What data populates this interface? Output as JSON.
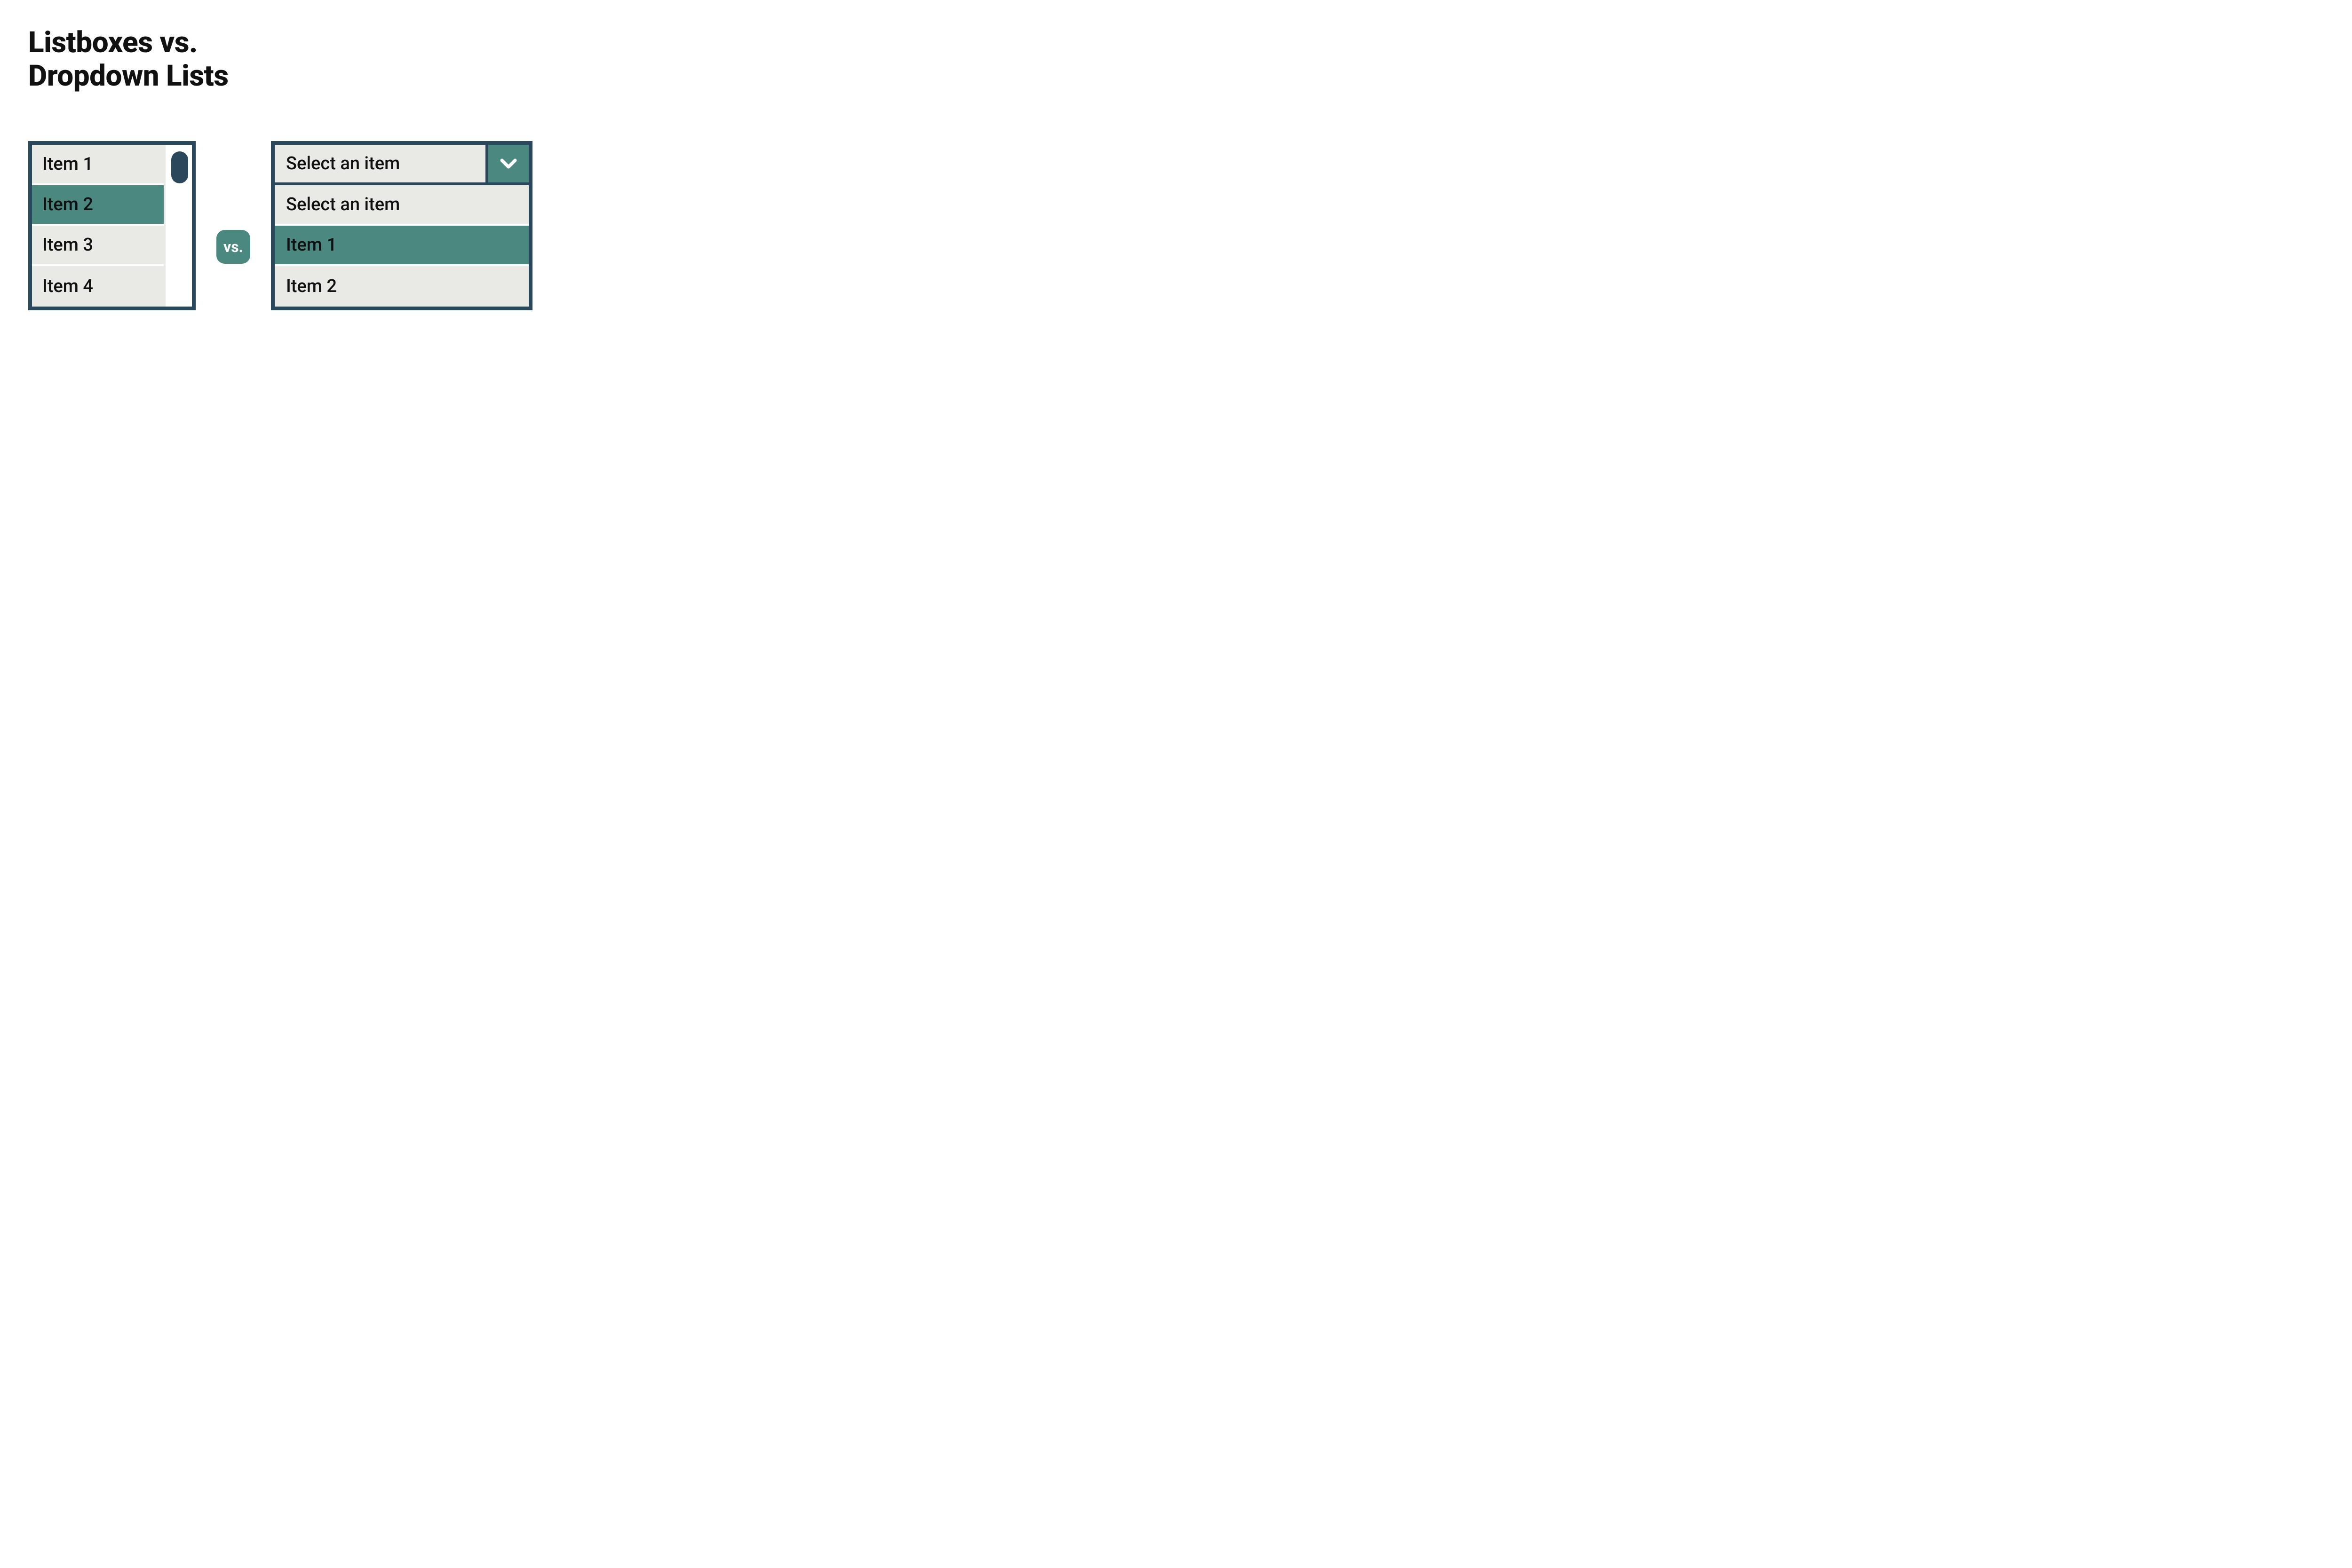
{
  "title_line1": "Listboxes vs.",
  "title_line2": "Dropdown Lists",
  "vs_label": "vs.",
  "listbox": {
    "items": [
      "Item 1",
      "Item 2",
      "Item 3",
      "Item 4"
    ],
    "selected_index": 1
  },
  "dropdown": {
    "placeholder": "Select an item",
    "options": [
      "Select an item",
      "Item 1",
      "Item 2"
    ],
    "selected_index": 1
  },
  "colors": {
    "border": "#2a475c",
    "accent": "#4b887f",
    "item_bg": "#e9e9e6"
  }
}
